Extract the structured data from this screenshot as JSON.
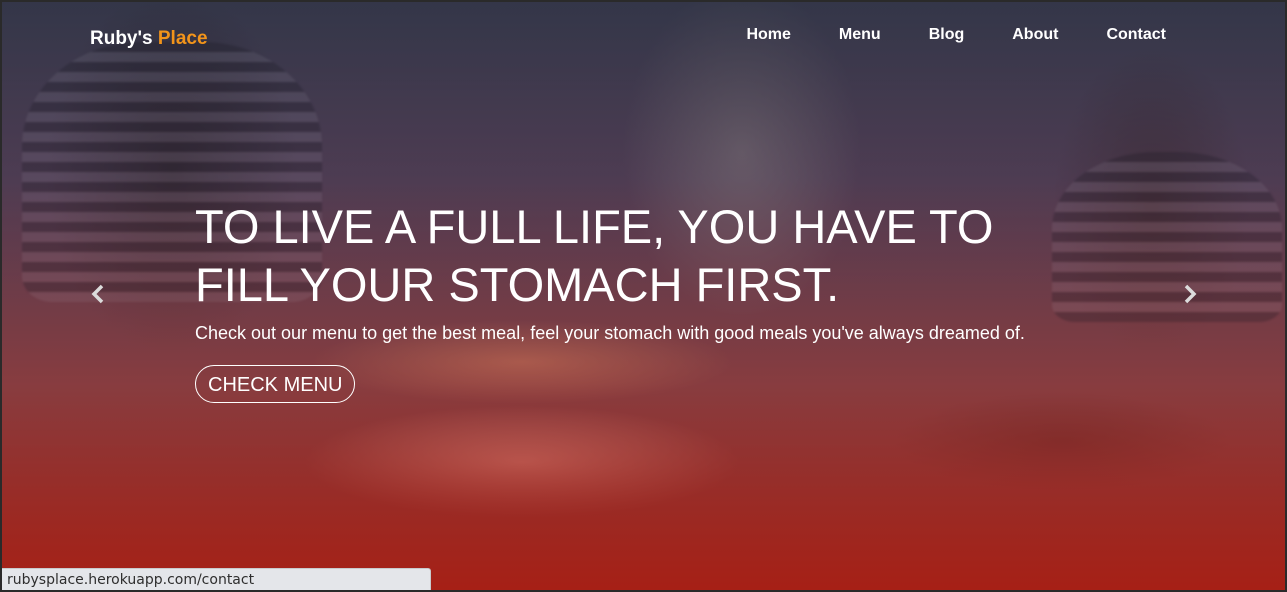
{
  "brand": {
    "name": "Ruby's",
    "accent": "Place",
    "accent_color": "#f2941a"
  },
  "nav": {
    "items": [
      {
        "label": "Home"
      },
      {
        "label": "Menu"
      },
      {
        "label": "Blog"
      },
      {
        "label": "About"
      },
      {
        "label": "Contact"
      }
    ]
  },
  "hero": {
    "headline_line1": "TO LIVE A FULL LIFE, YOU HAVE TO",
    "headline_line2": "FILL YOUR STOMACH FIRST.",
    "subtext": "Check out our menu to get the best meal, feel your stomach with good meals you've always dreamed of.",
    "cta_label": "CHECK MENU"
  },
  "carousel": {
    "prev_icon": "chevron-left-icon",
    "next_icon": "chevron-right-icon"
  },
  "status": {
    "url": "rubysplace.herokuapp.com/contact"
  }
}
